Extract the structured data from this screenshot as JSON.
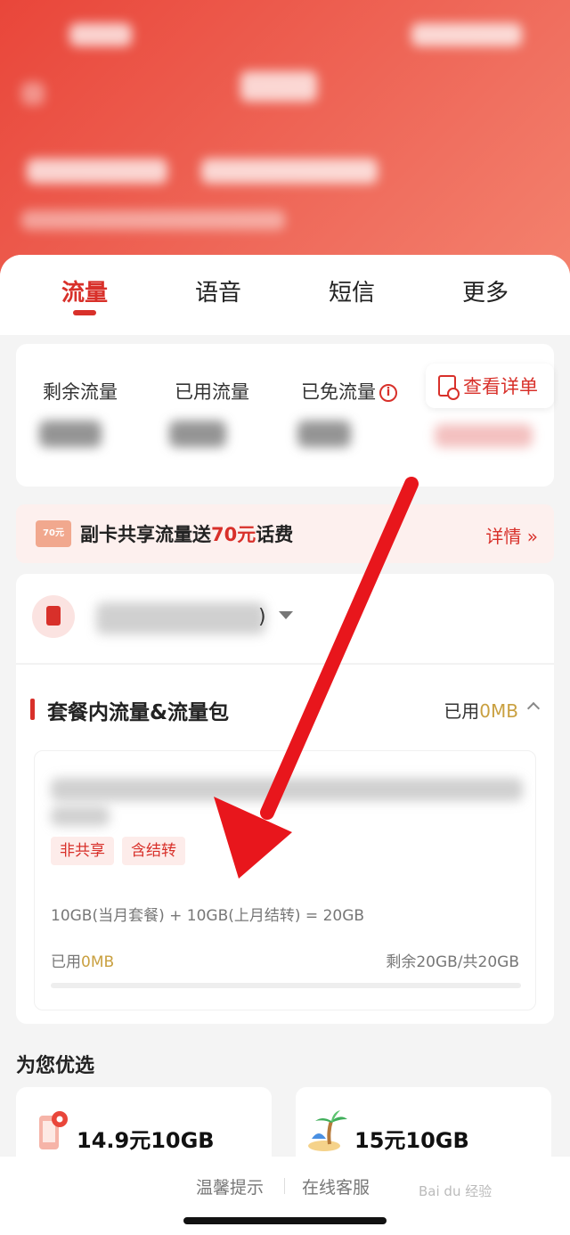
{
  "tabs": [
    {
      "label": "流量",
      "active": true
    },
    {
      "label": "语音",
      "active": false
    },
    {
      "label": "短信",
      "active": false
    },
    {
      "label": "更多",
      "active": false
    }
  ],
  "usage": {
    "remaining_label": "剩余流量",
    "used_label": "已用流量",
    "free_label": "已免流量",
    "info_glyph": "i",
    "detail_button": "查看详单"
  },
  "promo": {
    "coupon_text": "70元",
    "text_before": "副卡共享流量送",
    "highlight": "70元",
    "text_after": "话费",
    "link": "详情 »"
  },
  "phone": {
    "number_suffix": ")"
  },
  "plan_section": {
    "title": "套餐内流量&流量包",
    "used_prefix": "已用",
    "used_value": "0MB",
    "tags": [
      "非共享",
      "含结转"
    ],
    "formula": "10GB(当月套餐) + 10GB(上月结转) = 20GB",
    "bottom_used_prefix": "已用",
    "bottom_used_value": "0MB",
    "remaining": "剩余20GB/共20GB",
    "progress_fraction": 0
  },
  "recommend": {
    "title": "为您优选",
    "items": [
      {
        "label": "14.9元10GB",
        "icon": "phone-location-icon"
      },
      {
        "label": "15元10GB",
        "icon": "palm-tree-icon"
      }
    ]
  },
  "footer": {
    "tips": "温馨提示",
    "service": "在线客服",
    "watermark": "Bai du 经验"
  },
  "colors": {
    "accent": "#d8302a",
    "gold": "#c9a040",
    "header": "#e9463a",
    "arrow": "#e8161c"
  }
}
